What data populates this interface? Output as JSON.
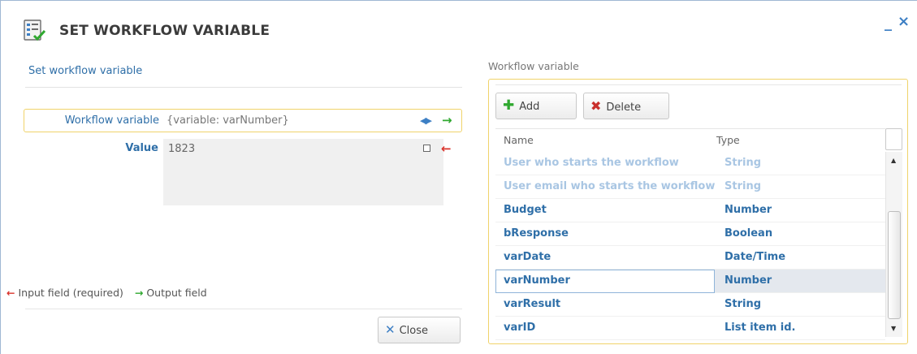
{
  "dialog": {
    "title": "SET WORKFLOW VARIABLE",
    "minimize_label": "_",
    "close_label": "×"
  },
  "left": {
    "heading": "Set workflow variable",
    "workflow_variable_label": "Workflow variable",
    "workflow_variable_value": "{variable: varNumber}",
    "value_label": "Value",
    "value_text": "1823",
    "legend_input": "Input field (required)",
    "legend_output": "Output field",
    "close_button": "Close"
  },
  "right": {
    "heading": "Workflow variable",
    "add_button": "Add",
    "delete_button": "Delete",
    "columns": [
      "Name",
      "Type"
    ],
    "rows": [
      {
        "name": "User who starts the workflow",
        "type": "String",
        "state": "dim"
      },
      {
        "name": "User email who starts the workflow",
        "type": "String",
        "state": "dim"
      },
      {
        "name": "Budget",
        "type": "Number",
        "state": "normal"
      },
      {
        "name": "bResponse",
        "type": "Boolean",
        "state": "normal"
      },
      {
        "name": "varDate",
        "type": "Date/Time",
        "state": "normal"
      },
      {
        "name": "varNumber",
        "type": "Number",
        "state": "selected"
      },
      {
        "name": "varResult",
        "type": "String",
        "state": "normal"
      },
      {
        "name": "varID",
        "type": "List item id.",
        "state": "normal"
      }
    ]
  },
  "colors": {
    "accent_blue": "#2f6fa8",
    "highlight_border": "#f0d36a",
    "input_arrow": "#d9332b",
    "output_arrow": "#2fa82f"
  },
  "icons": {
    "title": "workflow-form-icon",
    "swap": "swap-arrows-icon",
    "output": "green-arrow-right-icon",
    "input": "red-arrow-left-icon",
    "add": "plus-icon",
    "delete": "red-x-icon",
    "close": "blue-x-icon"
  }
}
